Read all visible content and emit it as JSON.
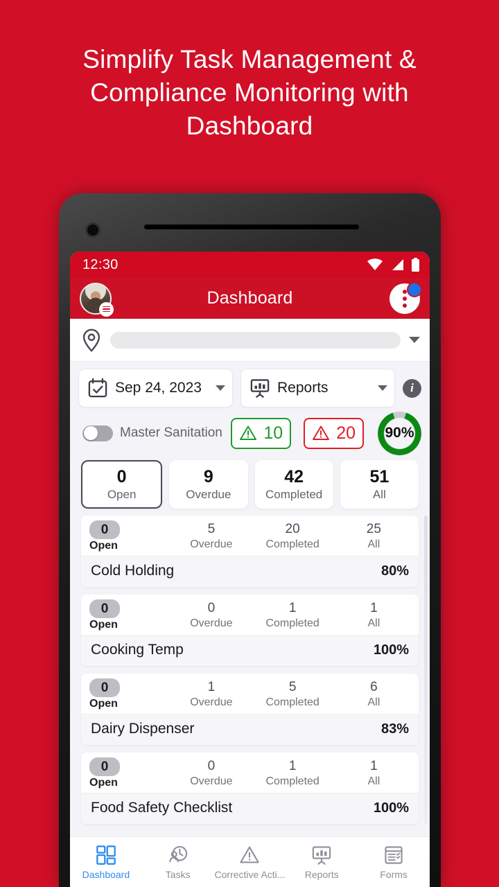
{
  "headline": "Simplify Task Management & Compliance Monitoring  with Dashboard",
  "colors": {
    "brand_red": "#d11028",
    "appbar_red": "#cc1026",
    "accent_blue": "#2d8cf0",
    "badge_blue": "#1b72e8",
    "green": "#1f9a2e",
    "red_alert": "#e01e27",
    "ring_green": "#0a8a14",
    "screen_bg": "#f4f4f8"
  },
  "status_bar": {
    "time": "12:30",
    "icons": [
      "wifi-icon",
      "cellular-signal-icon",
      "battery-icon"
    ]
  },
  "appbar": {
    "title": "Dashboard",
    "avatar": "user-avatar",
    "avatar_badge": "hamburger-menu-icon",
    "overflow": "overflow-menu-icon",
    "notification_badge": "notification-badge"
  },
  "location": {
    "icon": "location-pin-icon",
    "value": "",
    "placeholder": "",
    "caret": "chevron-down-icon"
  },
  "filters": {
    "date": {
      "icon": "calendar-check-icon",
      "label": "Sep 24, 2023"
    },
    "report": {
      "icon": "report-chart-icon",
      "label": "Reports"
    },
    "info": {
      "icon": "info-icon",
      "label": "i"
    }
  },
  "master": {
    "toggle_label": "Master Sanitation",
    "toggle_on": false,
    "warning_badge": {
      "icon": "warning-triangle-icon",
      "value": "10"
    },
    "alert_badge": {
      "icon": "alert-triangle-icon",
      "value": "20"
    },
    "progress": {
      "value": "90%",
      "percent": 90
    }
  },
  "summary_cards": [
    {
      "num": "0",
      "label": "Open",
      "selected": true
    },
    {
      "num": "9",
      "label": "Overdue",
      "selected": false
    },
    {
      "num": "42",
      "label": "Completed",
      "selected": false
    },
    {
      "num": "51",
      "label": "All",
      "selected": false
    }
  ],
  "stat_labels": [
    "Open",
    "Overdue",
    "Completed",
    "All"
  ],
  "tasks": [
    {
      "title": "Cold Holding",
      "open": "0",
      "overdue": "5",
      "completed": "20",
      "all": "25",
      "pct": "80%"
    },
    {
      "title": "Cooking Temp",
      "open": "0",
      "overdue": "0",
      "completed": "1",
      "all": "1",
      "pct": "100%"
    },
    {
      "title": "Dairy Dispenser",
      "open": "0",
      "overdue": "1",
      "completed": "5",
      "all": "6",
      "pct": "83%"
    },
    {
      "title": "Food Safety Checklist",
      "open": "0",
      "overdue": "0",
      "completed": "1",
      "all": "1",
      "pct": "100%"
    }
  ],
  "bottom_nav": [
    {
      "label": "Dashboard",
      "icon": "dashboard-grid-icon",
      "active": true
    },
    {
      "label": "Tasks",
      "icon": "tasks-clock-icon",
      "active": false
    },
    {
      "label": "Corrective Acti...",
      "icon": "warning-triangle-icon",
      "active": false
    },
    {
      "label": "Reports",
      "icon": "report-chart-icon",
      "active": false
    },
    {
      "label": "Forms",
      "icon": "forms-checklist-icon",
      "active": false
    }
  ]
}
